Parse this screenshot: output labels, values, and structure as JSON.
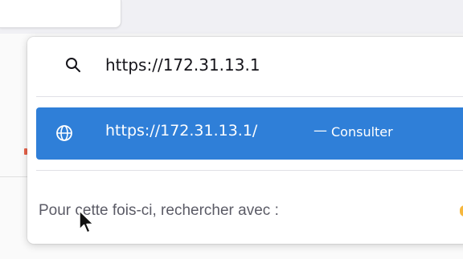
{
  "urlbar": {
    "value": "https://172.31.13.1",
    "search_icon": "search-icon"
  },
  "suggestion": {
    "icon": "globe-icon",
    "url": "https://172.31.13.1/",
    "dash": "—",
    "action": "Consulter"
  },
  "one_off": {
    "label": "Pour cette fois-ci, rechercher avec :"
  },
  "cursor": {
    "icon": "mouse-pointer-icon"
  },
  "colors": {
    "selection": "#2f7fd8",
    "text_primary": "#15141a",
    "text_muted": "#5b5b66",
    "popup_bg": "#ffffff"
  }
}
